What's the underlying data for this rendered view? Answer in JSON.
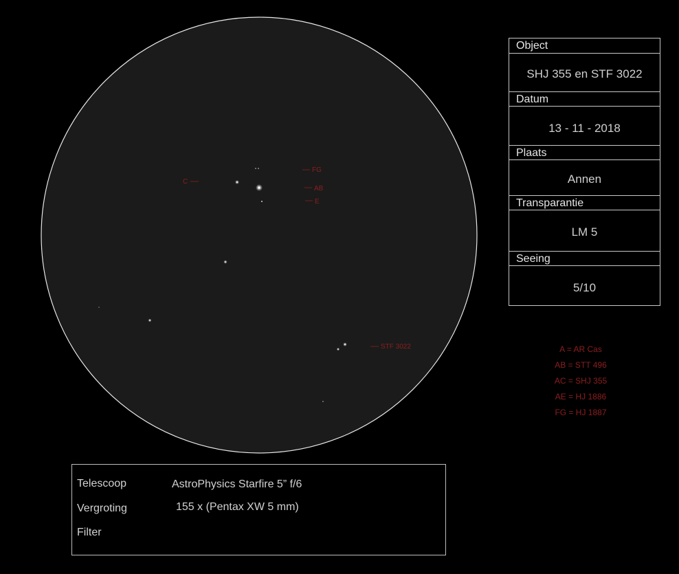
{
  "observation": {
    "object_label": "Object",
    "object_value": "SHJ 355 en STF 3022",
    "date_label": "Datum",
    "date_value": "13 - 11 - 2018",
    "place_label": "Plaats",
    "place_value": "Annen",
    "transparency_label": "Transparantie",
    "transparency_value": "LM 5",
    "seeing_label": "Seeing",
    "seeing_value": "5/10"
  },
  "equipment": {
    "telescope_label": "Telescoop",
    "telescope_value": "AstroPhysics Starfire 5” f/6",
    "magnification_label": "Vergroting",
    "magnification_value": "155 x (Pentax XW 5 mm)",
    "filter_label": "Filter",
    "filter_value": ""
  },
  "legend": [
    "A = AR Cas",
    "AB = STT 496",
    "AC = SHJ 355",
    "AE = HJ 1886",
    "FG = HJ 1887"
  ],
  "field_labels": {
    "c": "C",
    "fg": "FG",
    "ab": "AB",
    "e": "E",
    "stf": "STF 3022"
  },
  "colors": {
    "background": "#000000",
    "field": "#1b1b1b",
    "annotation": "#8e1e1e",
    "frame": "#c8c8c8"
  }
}
